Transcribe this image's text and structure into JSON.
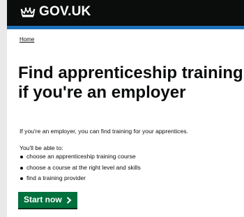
{
  "header": {
    "brand": "GOV.UK",
    "logo_icon": "crown-icon",
    "accent_color": "#1d70b8",
    "background_color": "#0b0c0c"
  },
  "breadcrumb": {
    "home_label": "Home"
  },
  "main": {
    "title_line1": "Find apprenticeship training",
    "title_line2": "if you're an employer",
    "lead": "If you're an employer, you can find training for your apprentices.",
    "able_intro": "You'll be able to:",
    "list": [
      "choose an apprenticeship training course",
      "choose a course at the right level and skills",
      "find a training provider"
    ],
    "start_button": {
      "label": "Start now",
      "icon": "chevron-right-icon",
      "color": "#00703c"
    }
  }
}
